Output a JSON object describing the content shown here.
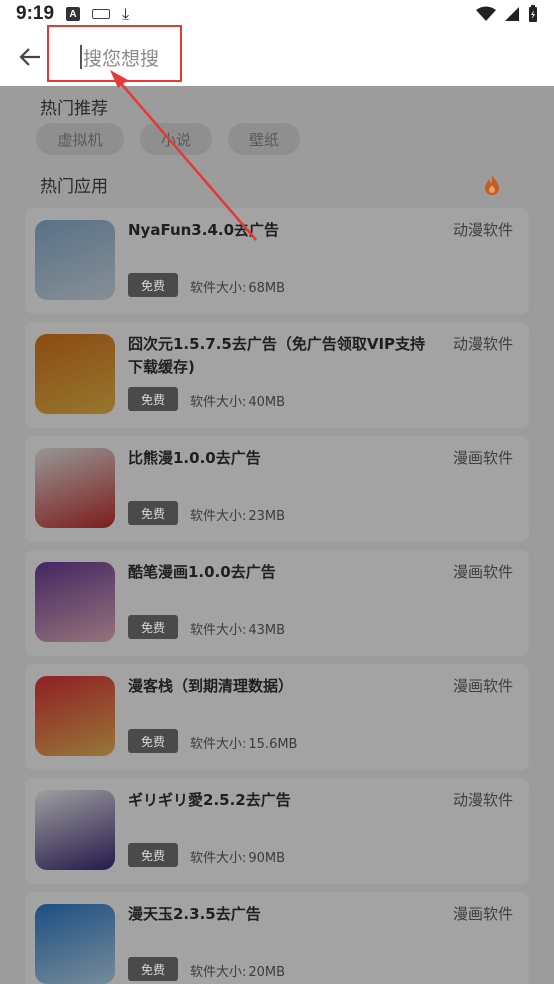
{
  "status_bar": {
    "time": "9:19",
    "a_icon": "A"
  },
  "search": {
    "placeholder": "搜您想搜"
  },
  "hot_recommend": {
    "title": "热门推荐",
    "chips": [
      "虚拟机",
      "小说",
      "壁纸"
    ]
  },
  "hot_apps": {
    "title": "热门应用",
    "size_label": "软件大小:",
    "items": [
      {
        "name": "NyaFun3.4.0去广告",
        "category": "动漫软件",
        "tag": "免费",
        "size": "68MB",
        "icon_colors": [
          "#8fb7d8",
          "#d9e6f2"
        ]
      },
      {
        "name": "囧次元1.5.7.5去广告（免广告领取VIP支持下载缓存)",
        "category": "动漫软件",
        "tag": "免费",
        "size": "40MB",
        "icon_colors": [
          "#e07a1e",
          "#f3c04a"
        ]
      },
      {
        "name": "比熊漫1.0.0去广告",
        "category": "漫画软件",
        "tag": "免费",
        "size": "23MB",
        "icon_colors": [
          "#f2f2f2",
          "#c9302c"
        ]
      },
      {
        "name": "酷笔漫画1.0.0去广告",
        "category": "漫画软件",
        "tag": "免费",
        "size": "43MB",
        "icon_colors": [
          "#6b3fa0",
          "#f2b8c6"
        ]
      },
      {
        "name": "漫客栈（到期清理数据）",
        "category": "漫画软件",
        "tag": "免费",
        "size": "15.6MB",
        "icon_colors": [
          "#e8323b",
          "#f5c05a"
        ]
      },
      {
        "name": "ギリギリ愛2.5.2去广告",
        "category": "动漫软件",
        "tag": "免费",
        "size": "90MB",
        "icon_colors": [
          "#ffffff",
          "#3c2a7a"
        ]
      },
      {
        "name": "漫天玉2.3.5去广告",
        "category": "漫画软件",
        "tag": "免费",
        "size": "20MB",
        "icon_colors": [
          "#2f7fd4",
          "#bfe1f7"
        ]
      }
    ]
  },
  "colors": {
    "annotation": "#e53935",
    "fire": "#e06a2a"
  }
}
